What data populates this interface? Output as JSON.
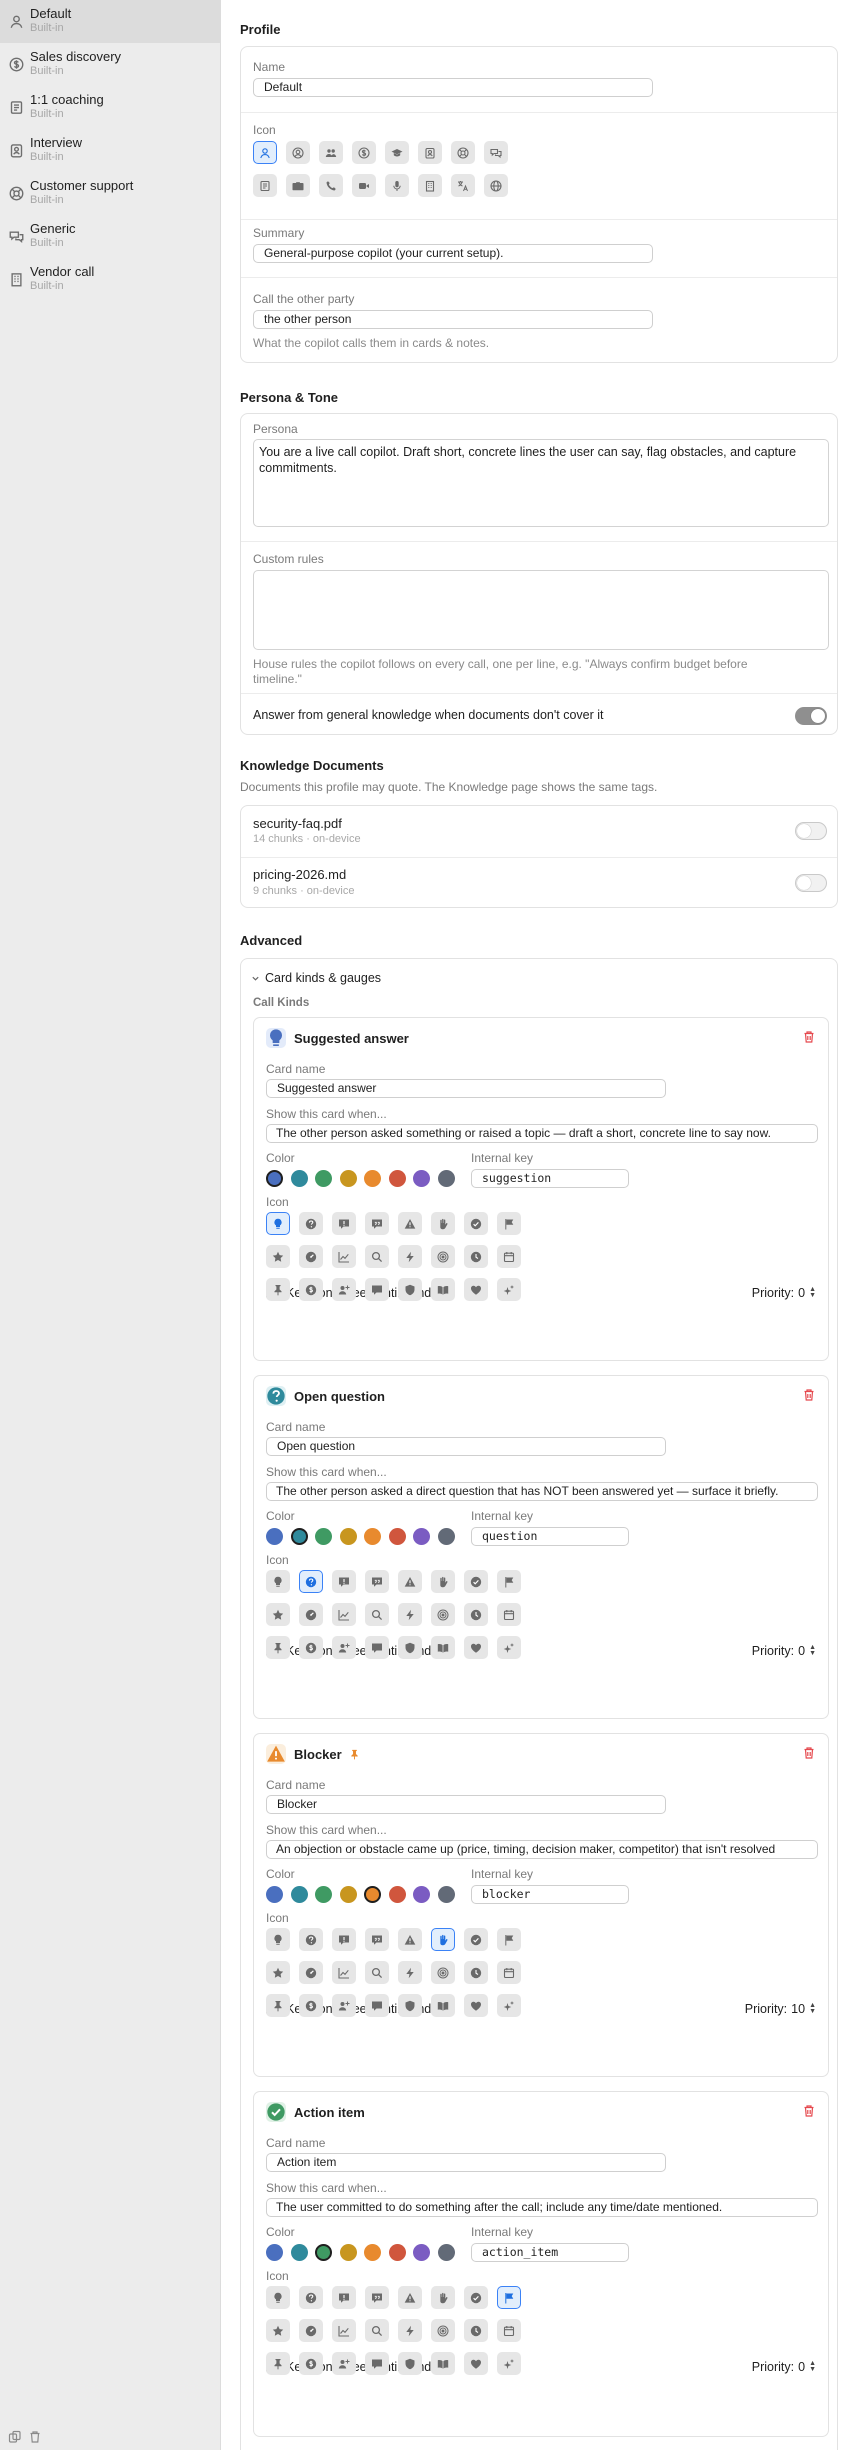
{
  "sidebar": {
    "items": [
      {
        "title": "Default",
        "sub": "Built-in",
        "icon": "person-icon"
      },
      {
        "title": "Sales discovery",
        "sub": "Built-in",
        "icon": "dollar-icon"
      },
      {
        "title": "1:1 coaching",
        "sub": "Built-in",
        "icon": "notebook-icon"
      },
      {
        "title": "Interview",
        "sub": "Built-in",
        "icon": "id-badge-icon"
      },
      {
        "title": "Customer support",
        "sub": "Built-in",
        "icon": "lifebuoy-icon"
      },
      {
        "title": "Generic",
        "sub": "Built-in",
        "icon": "chat-bubbles-icon"
      },
      {
        "title": "Vendor call",
        "sub": "Built-in",
        "icon": "building-icon"
      }
    ]
  },
  "profile": {
    "section_title": "Profile",
    "name_label": "Name",
    "name_value": "Default",
    "icon_label": "Icon",
    "summary_label": "Summary",
    "summary_value": "General-purpose copilot (your current setup).",
    "call_label": "Call the other party",
    "call_value": "the other person",
    "call_help": "What the copilot calls them in cards & notes."
  },
  "persona_tone": {
    "section_title": "Persona & Tone",
    "persona_label": "Persona",
    "persona_value": "You are a live call copilot. Draft short, concrete lines the user can say, flag obstacles, and capture commitments.",
    "custom_rules_label": "Custom rules",
    "custom_rules_value": "",
    "custom_rules_help": "House rules the copilot follows on every call, one per line, e.g. \"Always confirm budget before timeline.\"",
    "general_knowledge_label": "Answer from general knowledge when documents don't cover it",
    "general_knowledge_on": true
  },
  "knowledge": {
    "section_title": "Knowledge Documents",
    "subtitle": "Documents this profile may quote. The Knowledge page shows the same tags.",
    "docs": [
      {
        "name": "security-faq.pdf",
        "meta": "14 chunks · on-device",
        "enabled": false
      },
      {
        "name": "pricing-2026.md",
        "meta": "9 chunks · on-device",
        "enabled": false
      }
    ]
  },
  "advanced": {
    "section_title": "Advanced",
    "disclosure_label": "Card kinds & gauges",
    "call_kinds_label": "Call Kinds",
    "labels": {
      "card_name": "Card name",
      "show_when": "Show this card when...",
      "color": "Color",
      "internal_key": "Internal key",
      "icon": "Icon",
      "keep_on_screen": "Keep on screen until handled",
      "priority_prefix": "Priority:"
    },
    "colors": [
      "#4a6fbf",
      "#2f8a9c",
      "#3f9a63",
      "#c8961f",
      "#e88a2e",
      "#d0563d",
      "#7b5cc2",
      "#626a77"
    ],
    "kinds": [
      {
        "title": "Suggested answer",
        "name": "Suggested answer",
        "show_when": "The other person asked something or raised a topic — draft a short, concrete line to say now.",
        "key": "suggestion",
        "color_index": 0,
        "icon_index": 0,
        "keep": false,
        "priority": "0",
        "badge_color": "#4a6fbf",
        "badge_bg": "#e3ebfa",
        "pinned": false
      },
      {
        "title": "Open question",
        "name": "Open question",
        "show_when": "The other person asked a direct question that has NOT been answered yet — surface it briefly.",
        "key": "question",
        "color_index": 1,
        "icon_index": 1,
        "keep": false,
        "priority": "0",
        "badge_color": "#2f8a9c",
        "badge_bg": "#dff0f3",
        "pinned": false
      },
      {
        "title": "Blocker",
        "name": "Blocker",
        "show_when": "An objection or obstacle came up (price, timing, decision maker, competitor) that isn't resolved",
        "key": "blocker",
        "color_index": 4,
        "icon_index": 5,
        "keep": true,
        "priority": "10",
        "badge_color": "#e88a2e",
        "badge_bg": "#fbeedd",
        "pinned": true
      },
      {
        "title": "Action item",
        "name": "Action item",
        "show_when": "The user committed to do something after the call; include any time/date mentioned.",
        "key": "action_item",
        "color_index": 2,
        "icon_index": 7,
        "keep": false,
        "priority": "0",
        "badge_color": "#3f9a63",
        "badge_bg": "#e0f1e6",
        "pinned": false
      }
    ]
  }
}
